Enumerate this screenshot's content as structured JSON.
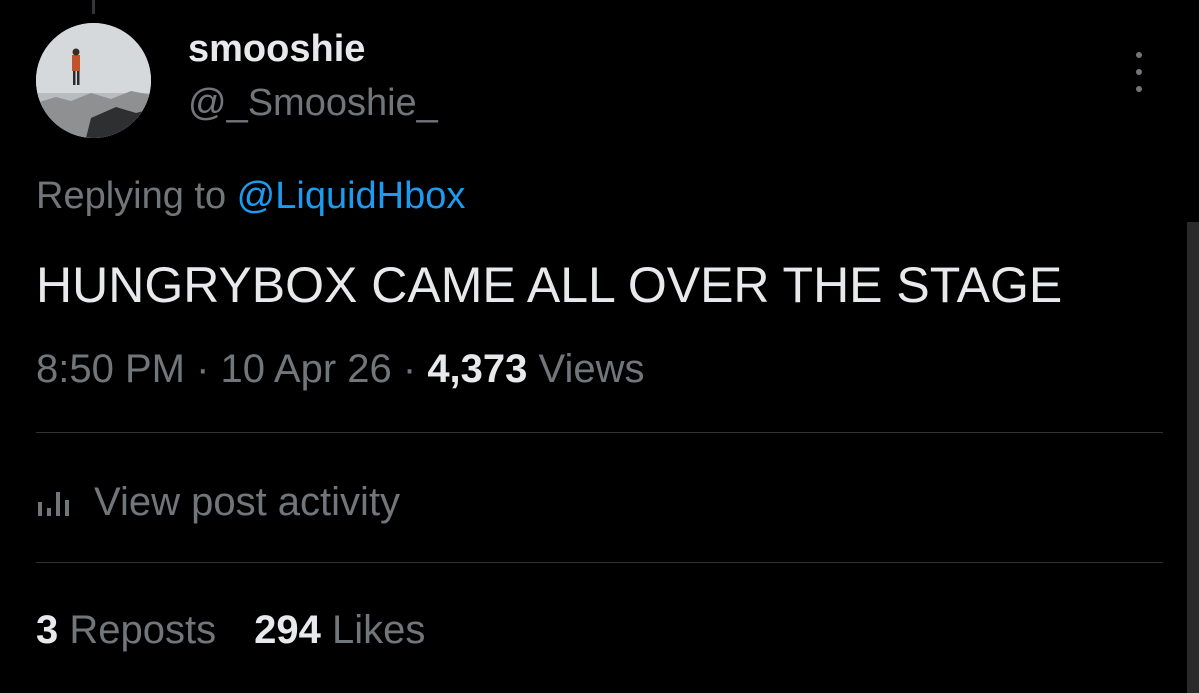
{
  "post": {
    "display_name": "smooshie",
    "handle": "@_Smooshie_",
    "replying_prefix": "Replying to ",
    "replying_to": "@LiquidHbox",
    "text": "HUNGRYBOX CAME ALL OVER THE STAGE",
    "time": "8:50 PM",
    "separator": " · ",
    "date": "10 Apr 26",
    "views_count": "4,373",
    "views_label": " Views"
  },
  "activity": {
    "label": "View post activity",
    "icon": "bar-chart-icon"
  },
  "stats": {
    "reposts_count": "3",
    "reposts_label": " Reposts",
    "likes_count": "294",
    "likes_label": " Likes"
  },
  "colors": {
    "background": "#000000",
    "primary_text": "#e7e9ea",
    "secondary_text": "#71767b",
    "link": "#1d9bf0",
    "divider": "#2f3336"
  }
}
